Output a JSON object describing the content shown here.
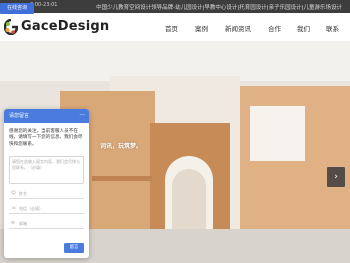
{
  "topbar": {
    "online_label": "在线咨询",
    "phone": "8:00-23:01",
    "slogan": "中国少儿教育空间设计领导品牌-幼儿园设计|早教中心设计|托育园设计|亲子乐园设计|儿童游乐场设计"
  },
  "brand": {
    "name": "GaceDesign"
  },
  "nav": [
    "首页",
    "案例",
    "新闻资讯",
    "合作",
    "我们",
    "联系"
  ],
  "hero": {
    "caption": "词讯，玩筑梦。",
    "prev_symbol": "‹",
    "next_symbol": "›"
  },
  "chat": {
    "title": "请您留言",
    "more_symbol": "···",
    "message": "感谢您的关注，当前客服人员不在线，请填写一下您的信息，我们会尽快和您联系。",
    "textarea_placeholder": "请您在此输入留言内容，我们会尽快与您联系。（必填）",
    "name_placeholder": "姓名",
    "phone_placeholder": "电话（必填）",
    "email_placeholder": "邮箱",
    "submit_label": "留言"
  },
  "colors": {
    "accent": "#4a7ce0",
    "topbar_bg": "#3d3d3d",
    "wood": "#d9a878"
  }
}
